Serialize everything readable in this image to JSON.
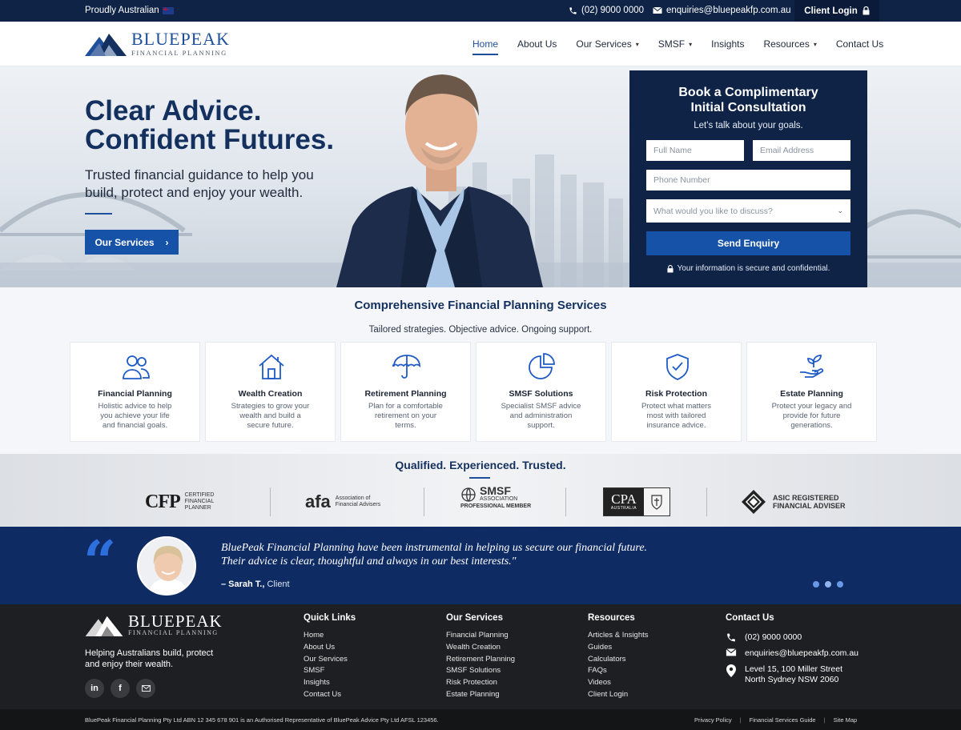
{
  "topbar": {
    "tagline": "Proudly Australian",
    "phone": "(02) 9000 0000",
    "email": "enquiries@bluepeakfp.com.au",
    "client_login": "Client Login"
  },
  "brand": {
    "name": "BLUEPEAK",
    "subname": "FINANCIAL PLANNING"
  },
  "nav": {
    "items": [
      {
        "label": "Home",
        "active": true
      },
      {
        "label": "About Us"
      },
      {
        "label": "Our Services",
        "dropdown": true
      },
      {
        "label": "SMSF",
        "dropdown": true
      },
      {
        "label": "Insights"
      },
      {
        "label": "Resources",
        "dropdown": true
      },
      {
        "label": "Contact Us"
      }
    ]
  },
  "hero": {
    "title_line1": "Clear Advice.",
    "title_line2": "Confident Futures.",
    "subtitle": "Trusted financial guidance to help you build, protect and enjoy your wealth.",
    "cta": "Our Services"
  },
  "consult": {
    "title_line1": "Book a Complimentary",
    "title_line2": "Initial Consultation",
    "subtitle": "Let's talk about your goals.",
    "full_name_placeholder": "Full Name",
    "email_placeholder": "Email Address",
    "phone_placeholder": "Phone Number",
    "discuss_placeholder": "What would you like to discuss?",
    "submit": "Send Enquiry",
    "secure_note": "Your information is secure and confidential."
  },
  "services": {
    "title": "Comprehensive Financial Planning Services",
    "subtitle": "Tailored strategies. Objective advice. Ongoing support.",
    "cards": [
      {
        "icon": "people-icon",
        "title": "Financial Planning",
        "text": "Holistic advice to help you achieve your life and financial goals."
      },
      {
        "icon": "house-icon",
        "title": "Wealth Creation",
        "text": "Strategies to grow your wealth and build a secure future."
      },
      {
        "icon": "umbrella-icon",
        "title": "Retirement Planning",
        "text": "Plan for a comfortable retirement on your terms."
      },
      {
        "icon": "pie-chart-icon",
        "title": "SMSF Solutions",
        "text": "Specialist SMSF advice and administration support."
      },
      {
        "icon": "shield-check-icon",
        "title": "Risk Protection",
        "text": "Protect what matters most with tailored insurance advice."
      },
      {
        "icon": "hand-plant-icon",
        "title": "Estate Planning",
        "text": "Protect your legacy and provide for future generations."
      }
    ]
  },
  "trust": {
    "title": "Qualified. Experienced. Trusted.",
    "cfp_mark": "CFP",
    "cfp_text": "CERTIFIED FINANCIAL PLANNER",
    "afa_mark": "afa",
    "afa_text_1": "Association of",
    "afa_text_2": "Financial Advisers",
    "smsf_mark": "SMSF",
    "smsf_assoc": "ASSOCIATION",
    "smsf_member": "PROFESSIONAL MEMBER",
    "cpa_mark": "CPA",
    "cpa_sub": "AUSTRALIA",
    "asic_line1": "ASIC REGISTERED",
    "asic_line2": "FINANCIAL ADVISER"
  },
  "testimonial": {
    "quote_line1": "BluePeak Financial Planning have been instrumental in helping us secure our financial future.",
    "quote_line2": "Their advice is clear, thoughtful and always in our best interests.\"",
    "author_name": "– Sarah T.,",
    "author_role": "Client",
    "slides": 3,
    "active_slide": 2
  },
  "footer": {
    "tagline": "Helping Australians build, protect and enjoy their wealth.",
    "quick_links_title": "Quick Links",
    "quick_links": [
      "Home",
      "About Us",
      "Our Services",
      "SMSF",
      "Insights",
      "Contact Us"
    ],
    "services_title": "Our Services",
    "services": [
      "Financial Planning",
      "Wealth Creation",
      "Retirement Planning",
      "SMSF Solutions",
      "Risk Protection",
      "Estate Planning"
    ],
    "resources_title": "Resources",
    "resources": [
      "Articles & Insights",
      "Guides",
      "Calculators",
      "FAQs",
      "Videos",
      "Client Login"
    ],
    "contact_title": "Contact Us",
    "contact_phone": "(02) 9000 0000",
    "contact_email": "enquiries@bluepeakfp.com.au",
    "address_line1": "Level 15, 100 Miller Street",
    "address_line2": "North Sydney NSW 2060",
    "social_linkedin": "in",
    "social_facebook": "f"
  },
  "bottom": {
    "legal": "BluePeak Financial Planning Pty Ltd ABN 12 345 678 901 is an Authorised Representative of BluePeak Advice Pty Ltd AFSL 123456.",
    "privacy": "Privacy Policy",
    "fsg": "Financial Services Guide",
    "sitemap": "Site Map"
  },
  "colors": {
    "navy": "#0f2347",
    "brand_blue": "#1552a8",
    "testimonial_bg": "#0f2b63",
    "footer_bg": "#1e1f22"
  }
}
